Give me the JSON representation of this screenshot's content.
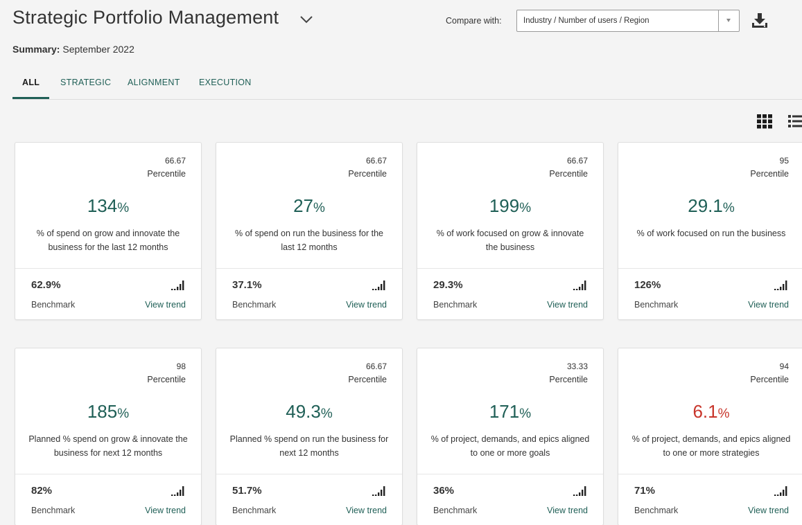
{
  "header": {
    "title": "Strategic Portfolio Management",
    "summary_label": "Summary:",
    "summary_value": "September 2022",
    "compare_label": "Compare with:",
    "compare_value": "Industry / Number of users / Region"
  },
  "tabs": [
    {
      "label": "ALL",
      "active": true
    },
    {
      "label": "STRATEGIC",
      "active": false
    },
    {
      "label": "ALIGNMENT",
      "active": false
    },
    {
      "label": "EXECUTION",
      "active": false
    }
  ],
  "colors": {
    "accent": "#1f5f56",
    "negative": "#c8352b",
    "background": "#f4f4f4",
    "card": "#ffffff"
  },
  "icons": {
    "title_dropdown": "chevron-down-icon",
    "download": "download-icon",
    "grid_view": "grid-view-icon",
    "list_view": "list-view-icon",
    "signal": "signal-bars-icon"
  },
  "cards": [
    {
      "percentile": "66.67",
      "percentile_label": "Percentile",
      "value": "134",
      "unit": "%",
      "status": "positive",
      "description": "% of spend on grow and innovate the business for the last 12 months",
      "benchmark_value": "62.9%",
      "benchmark_label": "Benchmark",
      "trend_label": "View trend"
    },
    {
      "percentile": "66.67",
      "percentile_label": "Percentile",
      "value": "27",
      "unit": "%",
      "status": "positive",
      "description": "% of spend on run the business for the last 12 months",
      "benchmark_value": "37.1%",
      "benchmark_label": "Benchmark",
      "trend_label": "View trend"
    },
    {
      "percentile": "66.67",
      "percentile_label": "Percentile",
      "value": "199",
      "unit": "%",
      "status": "positive",
      "description": "% of work focused on grow & innovate the business",
      "benchmark_value": "29.3%",
      "benchmark_label": "Benchmark",
      "trend_label": "View trend"
    },
    {
      "percentile": "95",
      "percentile_label": "Percentile",
      "value": "29.1",
      "unit": "%",
      "status": "positive",
      "description": "% of work focused on run the business",
      "benchmark_value": "126%",
      "benchmark_label": "Benchmark",
      "trend_label": "View trend"
    },
    {
      "percentile": "98",
      "percentile_label": "Percentile",
      "value": "185",
      "unit": "%",
      "status": "positive",
      "description": "Planned % spend on grow & innovate the business for next 12 months",
      "benchmark_value": "82%",
      "benchmark_label": "Benchmark",
      "trend_label": "View trend"
    },
    {
      "percentile": "66.67",
      "percentile_label": "Percentile",
      "value": "49.3",
      "unit": "%",
      "status": "positive",
      "description": "Planned % spend on run the business for next 12 months",
      "benchmark_value": "51.7%",
      "benchmark_label": "Benchmark",
      "trend_label": "View trend"
    },
    {
      "percentile": "33.33",
      "percentile_label": "Percentile",
      "value": "171",
      "unit": "%",
      "status": "positive",
      "description": "% of project, demands, and epics aligned to one or more goals",
      "benchmark_value": "36%",
      "benchmark_label": "Benchmark",
      "trend_label": "View trend"
    },
    {
      "percentile": "94",
      "percentile_label": "Percentile",
      "value": "6.1",
      "unit": "%",
      "status": "negative",
      "description": "% of project, demands, and epics aligned to one or more strategies",
      "benchmark_value": "71%",
      "benchmark_label": "Benchmark",
      "trend_label": "View trend"
    }
  ]
}
